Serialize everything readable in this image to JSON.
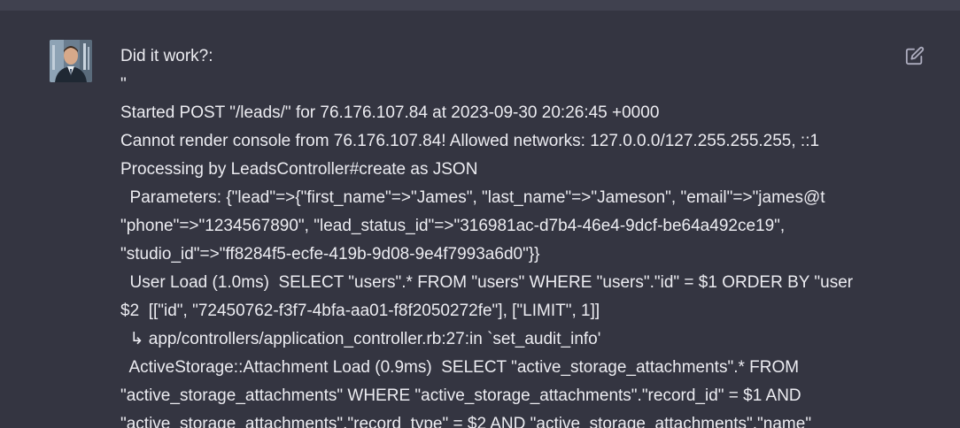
{
  "message": {
    "edit_icon": "edit-icon",
    "avatar_icon": "user-avatar-photo",
    "lines": [
      "Did it work?:",
      "\"",
      "Started POST \"/leads/\" for 76.176.107.84 at 2023-09-30 20:26:45 +0000",
      "Cannot render console from 76.176.107.84! Allowed networks: 127.0.0.0/127.255.255.255, ::1",
      "Processing by LeadsController#create as JSON",
      "  Parameters: {\"lead\"=>{\"first_name\"=>\"James\", \"last_name\"=>\"Jameson\", \"email\"=>\"james@t",
      "\"phone\"=>\"1234567890\", \"lead_status_id\"=>\"316981ac-d7b4-46e4-9dcf-be64a492ce19\",",
      "\"studio_id\"=>\"ff8284f5-ecfe-419b-9d08-9e4f7993a6d0\"}}",
      "  User Load (1.0ms)  SELECT \"users\".* FROM \"users\" WHERE \"users\".\"id\" = $1 ORDER BY \"user",
      "$2  [[\"id\", \"72450762-f3f7-4bfa-aa01-f8f2050272fe\"], [\"LIMIT\", 1]]",
      "  ↳ app/controllers/application_controller.rb:27:in `set_audit_info'",
      "  ActiveStorage::Attachment Load (0.9ms)  SELECT \"active_storage_attachments\".* FROM",
      "\"active_storage_attachments\" WHERE \"active_storage_attachments\".\"record_id\" = $1 AND",
      "\"active_storage_attachments\".\"record_type\" = $2 AND \"active_storage_attachments\".\"name\""
    ]
  }
}
